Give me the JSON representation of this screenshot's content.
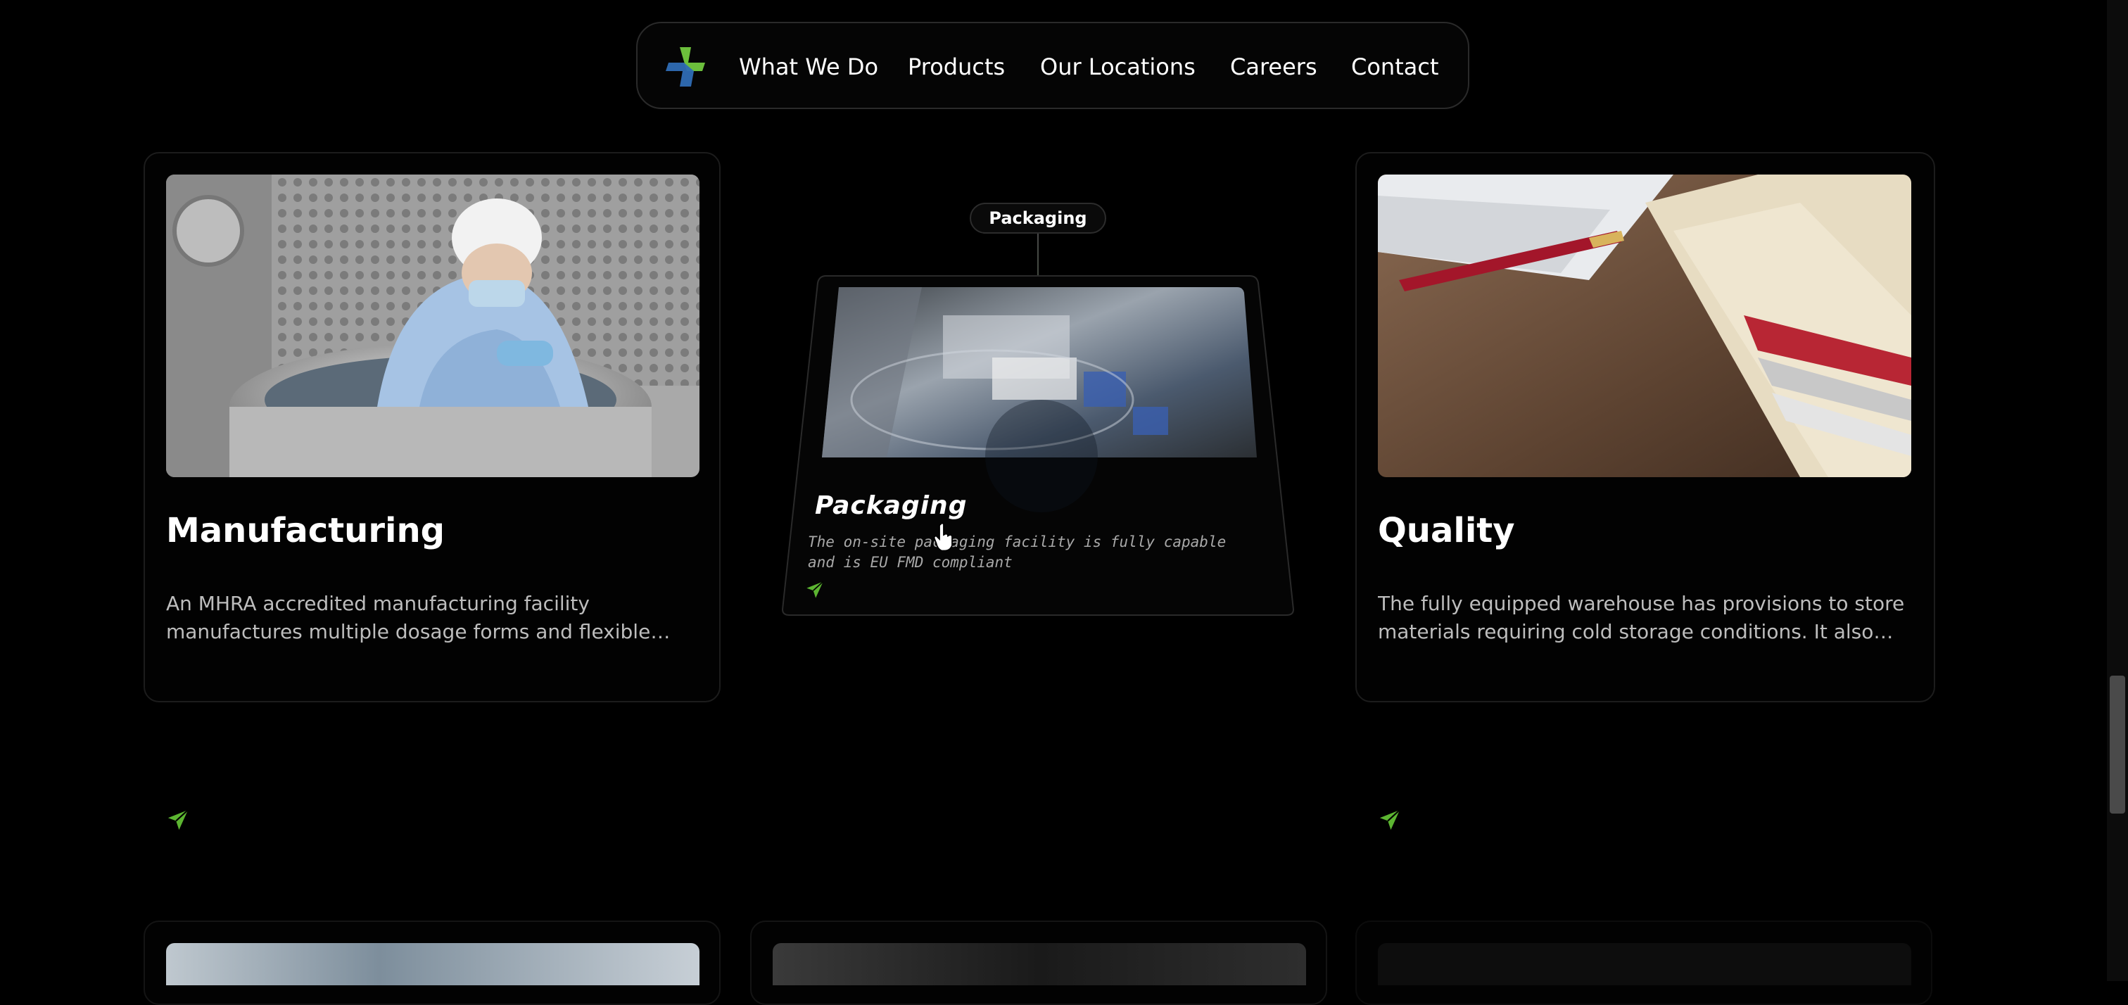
{
  "nav": {
    "items": [
      {
        "label": "What We Do"
      },
      {
        "label": "Products"
      },
      {
        "label": "Our Locations"
      },
      {
        "label": "Careers"
      },
      {
        "label": "Contact"
      }
    ],
    "logo_colors": {
      "green": "#6cbf3c",
      "blue": "#2f6db5"
    }
  },
  "cards": [
    {
      "title": "Manufacturing",
      "description": "An MHRA accredited manufacturing facility manufactures multiple dosage forms and flexible batch sizes",
      "icon": "send-arrow-icon"
    },
    {
      "title": "Packaging",
      "tooltip": "Packaging",
      "description": "The on-site packaging facility is fully capable and is EU FMD compliant",
      "icon": "send-arrow-icon"
    },
    {
      "title": "Quality",
      "description": "The fully equipped warehouse has provisions to store materials requiring cold storage conditions. It also maintains records",
      "icon": "send-arrow-icon"
    }
  ],
  "colors": {
    "accent": "#5cb531",
    "background": "#000000"
  }
}
